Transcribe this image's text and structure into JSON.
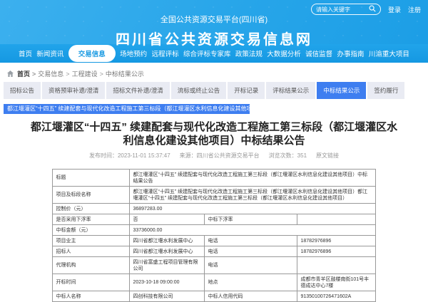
{
  "colors": {
    "header_blue": "#27a5e9",
    "nav_blue": "#1a9ae2",
    "accent_blue": "#3e7ef0",
    "tab_inactive_bg": "#e9ebf3",
    "table_border": "#999999"
  },
  "header": {
    "search_placeholder": "请输入关键字",
    "search_icon": "magnifier",
    "login_label": "登录",
    "register_label": "注册",
    "platform_title": "全国公共资源交易平台(四川省)",
    "site_title": "四川省公共资源交易信息网"
  },
  "nav": {
    "items": [
      "首页",
      "新闻资讯",
      "交易信息",
      "场地预约",
      "远程评标",
      "综合评标专家库",
      "政策法规",
      "大数据分析",
      "诚信监督",
      "办事指南",
      "川渝重大项目"
    ],
    "active_index": 2
  },
  "breadcrumb": {
    "items": [
      "首页",
      "交易信息",
      "工程建设",
      "中标结果公示"
    ]
  },
  "tabs": {
    "items": [
      "招标公告",
      "资格预审补遗/澄清",
      "招标文件补遗/澄清",
      "流标或终止公告",
      "开标记录",
      "评标结果公示",
      "中标结果公示",
      "签约履行"
    ],
    "active_index": 6
  },
  "marquee": {
    "text": "都江堰灌区“十四五” 续建配套与现代化改造工程施工第三标段（都江堰灌区水利信息化建设其他项目）中标结果公告"
  },
  "article": {
    "title": "都江堰灌区“十四五” 续建配套与现代化改造工程施工第三标段（都江堰灌区水利信息化建设其他项目）中标结果公告",
    "published": "发布时间：2023-11-01 15:37:47",
    "source": "来源：四川省公共资源交易平台",
    "views": "浏览次数：351",
    "original_link": "原文链接"
  },
  "table": {
    "rows": [
      {
        "label": "标题",
        "value": "都江堰灌区“十四五” 续建配套与现代化改造工程施工第三标段（都江堰灌区水利信息化建设其他项目）中标结果公告"
      },
      {
        "label": "项目及标段名称",
        "value": "都江堰灌区“十四五” 续建配套与现代化改造工程施工第三标段（都江堰灌区水利信息化建设其他项目）都江堰灌区“十四五” 续建配套与现代化改造工程施工第三标段（都江堰灌区水利信息化建设其他项目）"
      },
      {
        "label": "控制价（元）",
        "value": "36897283.00"
      },
      {
        "label": "是否采用下浮率",
        "value": "否",
        "label2": "中标下浮率",
        "value2": ""
      },
      {
        "label": "中标金额（元）",
        "value": "33736000.00"
      },
      {
        "label": "项目业主",
        "value": "四川省都江堰水利发展中心",
        "label2": "电话",
        "value2": "18782976896"
      },
      {
        "label": "招标人",
        "value": "四川省都江堰水利发展中心",
        "label2": "电话",
        "value2": "18782976896"
      },
      {
        "label": "代理机构",
        "value": "四川省富盛工程项目管理有限公司",
        "label2": "电话",
        "value2": ""
      },
      {
        "label": "开标时间",
        "value": "2023-10-18 09:00:00",
        "label2": "地点",
        "value2": "成都市青羊区鼓楼南街101号丰德成达中心7楼"
      },
      {
        "label": "中标人名称",
        "value": "四创科技有限公司",
        "label2": "中标人信用代码",
        "value2": "91350100726471602A"
      }
    ]
  }
}
